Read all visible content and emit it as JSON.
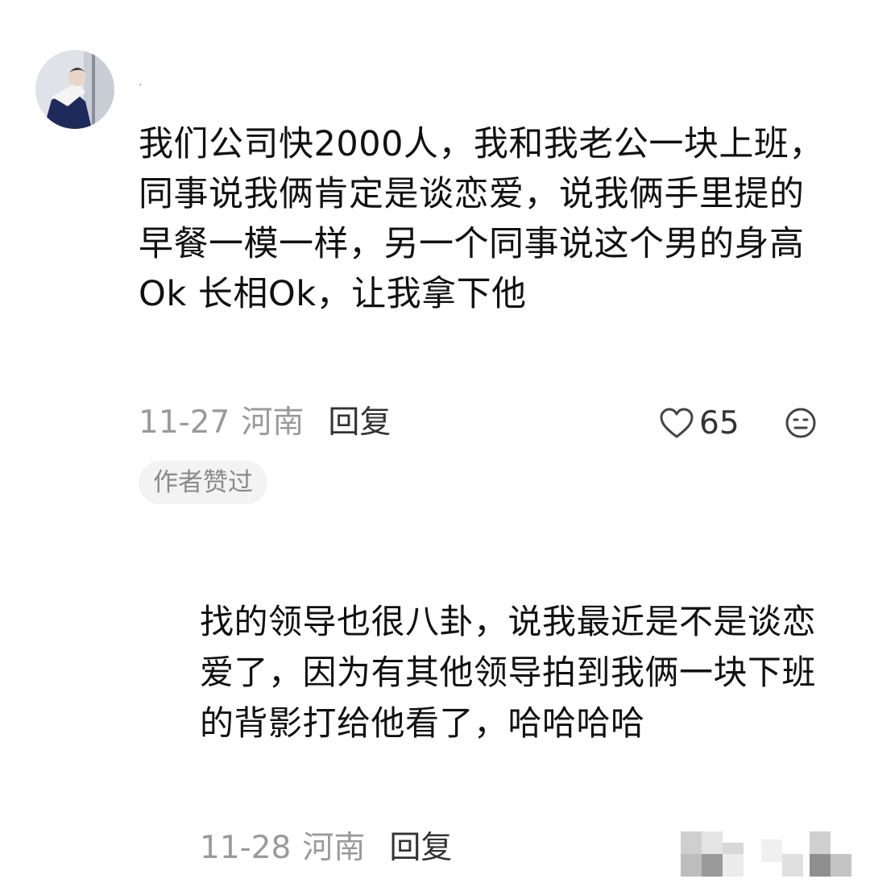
{
  "comments": [
    {
      "username": ".",
      "text": "我们公司快2000人，我和我老公一块上班，同事说我俩肯定是谈恋爱，说我俩手里提的早餐一模一样，另一个同事说这个男的身高Ok 长相Ok，让我拿下他",
      "date": "11-27",
      "location": "河南",
      "reply_label": "回复",
      "like_count": "65",
      "badge": "作者赞过",
      "icons": [
        "avatar-photo",
        "heart-outline-icon",
        "emoji-face-icon"
      ]
    },
    {
      "text": "找的领导也很八卦，说我最近是不是谈恋爱了，因为有其他领导拍到我俩一块下班的背影打给他看了，哈哈哈哈",
      "date": "11-28",
      "location": "河南",
      "reply_label": "回复",
      "icons": [
        "pixelated-region"
      ]
    }
  ],
  "colors": {
    "text": "#111111",
    "meta": "#9a9a9a",
    "reply": "#333333",
    "badge_bg": "#f3f3f3"
  }
}
